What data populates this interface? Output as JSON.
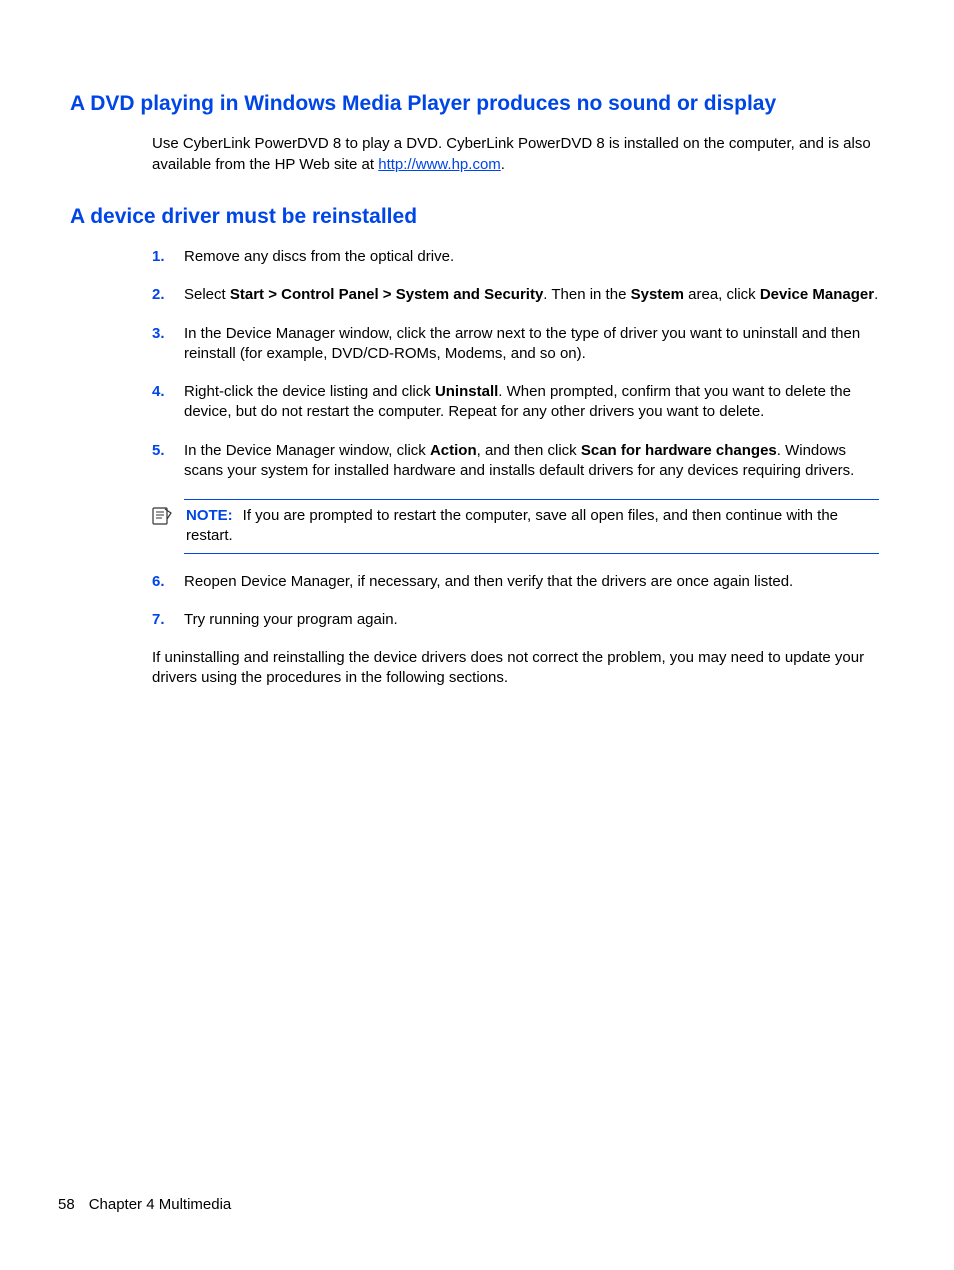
{
  "section1": {
    "heading": "A DVD playing in Windows Media Player produces no sound or display",
    "para_pre": "Use CyberLink PowerDVD 8 to play a DVD. CyberLink PowerDVD 8 is installed on the computer, and is also available from the HP Web site at ",
    "link_text": "http://www.hp.com",
    "para_post": "."
  },
  "section2": {
    "heading": "A device driver must be reinstalled",
    "steps": {
      "n1": "1.",
      "t1": "Remove any discs from the optical drive.",
      "n2": "2.",
      "t2a": "Select ",
      "t2b": "Start > Control Panel > System and Security",
      "t2c": ". Then in the ",
      "t2d": "System",
      "t2e": " area, click ",
      "t2f": "Device Manager",
      "t2g": ".",
      "n3": "3.",
      "t3": "In the Device Manager window, click the arrow next to the type of driver you want to uninstall and then reinstall (for example, DVD/CD-ROMs, Modems, and so on).",
      "n4": "4.",
      "t4a": "Right-click the device listing and click ",
      "t4b": "Uninstall",
      "t4c": ". When prompted, confirm that you want to delete the device, but do not restart the computer. Repeat for any other drivers you want to delete.",
      "n5": "5.",
      "t5a": "In the Device Manager window, click ",
      "t5b": "Action",
      "t5c": ", and then click ",
      "t5d": "Scan for hardware changes",
      "t5e": ". Windows scans your system for installed hardware and installs default drivers for any devices requiring drivers.",
      "n6": "6.",
      "t6": "Reopen Device Manager, if necessary, and then verify that the drivers are once again listed.",
      "n7": "7.",
      "t7": "Try running your program again."
    },
    "note": {
      "label": "NOTE:",
      "text": "If you are prompted to restart the computer, save all open files, and then continue with the restart."
    },
    "tail": "If uninstalling and reinstalling the device drivers does not correct the problem, you may need to update your drivers using the procedures in the following sections."
  },
  "footer": {
    "page": "58",
    "chapter": "Chapter 4   Multimedia"
  }
}
